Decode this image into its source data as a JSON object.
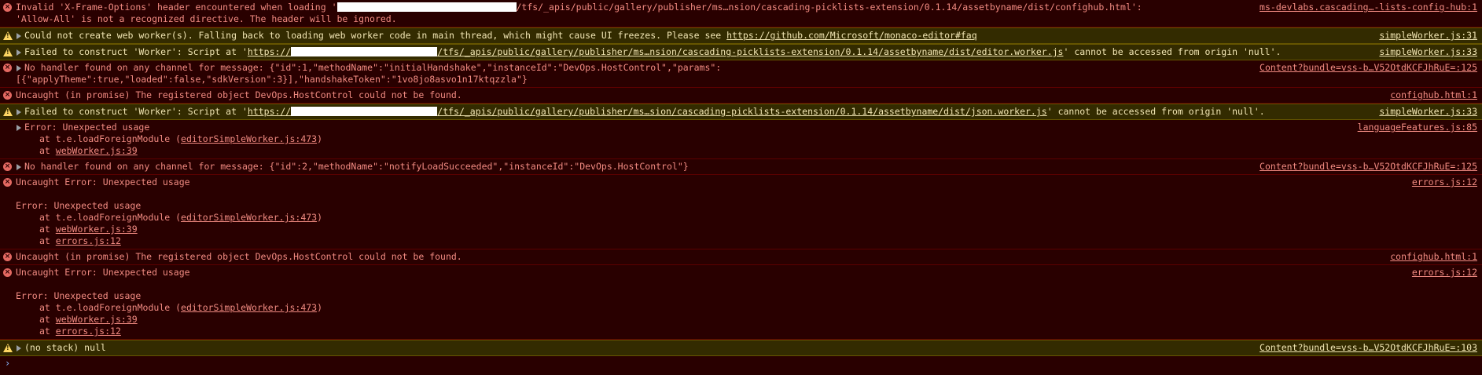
{
  "messages": [
    {
      "level": "error",
      "lines": [
        "Invalid 'X-Frame-Options' header encountered when loading '",
        "'Allow-All' is not a recognized directive. The header will be ignored."
      ],
      "url_tail": "/tfs/_apis/public/gallery/publisher/ms…nsion/cascading-picklists-extension/0.1.14/assetbyname/dist/confighub.html':",
      "source": "ms-devlabs.cascading…-lists-config-hub:1"
    },
    {
      "level": "warning",
      "text": "Could not create web worker(s). Falling back to loading web worker code in main thread, which might cause UI freezes. Please see ",
      "link": "https://github.com/Microsoft/monaco-editor#faq",
      "source": "simpleWorker.js:31"
    },
    {
      "level": "warning",
      "prefix": "Failed to construct 'Worker': Script at '",
      "link_start": "https://",
      "link_end": "/tfs/_apis/public/gallery/publisher/ms…nsion/cascading-picklists-extension/0.1.14/assetbyname/dist/editor.worker.js",
      "suffix": "' cannot be accessed from origin 'null'.",
      "source": "simpleWorker.js:33"
    },
    {
      "level": "error",
      "lines": [
        "No handler found on any channel for message: {\"id\":1,\"methodName\":\"initialHandshake\",\"instanceId\":\"DevOps.HostControl\",\"params\":",
        "[{\"applyTheme\":true,\"loaded\":false,\"sdkVersion\":3}],\"handshakeToken\":\"1vo8jo8asvo1n17ktqzzla\"}"
      ],
      "source": "Content?bundle=vss-b…V52OtdKCFJhRuE=:125"
    },
    {
      "level": "error",
      "text": "Uncaught (in promise) The registered object DevOps.HostControl could not be found.",
      "source": "confighub.html:1"
    },
    {
      "level": "warning",
      "prefix": "Failed to construct 'Worker': Script at '",
      "link_start": "https://",
      "link_end": "/tfs/_apis/public/gallery/publisher/ms…sion/cascading-picklists-extension/0.1.14/assetbyname/dist/json.worker.js",
      "suffix": "' cannot be accessed from origin 'null'.",
      "source": "simpleWorker.js:33"
    },
    {
      "level": "error",
      "text": "Error: Unexpected usage",
      "stack": [
        {
          "pre": "at t.e.loadForeignModule (",
          "link": "editorSimpleWorker.js:473",
          "post": ")"
        },
        {
          "pre": "at ",
          "link": "webWorker.js:39",
          "post": ""
        }
      ],
      "source": "languageFeatures.js:85"
    },
    {
      "level": "error",
      "text": "No handler found on any channel for message: {\"id\":2,\"methodName\":\"notifyLoadSucceeded\",\"instanceId\":\"DevOps.HostControl\"}",
      "source": "Content?bundle=vss-b…V52OtdKCFJhRuE=:125"
    },
    {
      "level": "error",
      "text": "Uncaught Error: Unexpected usage",
      "detail": "Error: Unexpected usage",
      "stack": [
        {
          "pre": "at t.e.loadForeignModule (",
          "link": "editorSimpleWorker.js:473",
          "post": ")"
        },
        {
          "pre": "at ",
          "link": "webWorker.js:39",
          "post": ""
        },
        {
          "pre": "at ",
          "link": "errors.js:12",
          "post": ""
        }
      ],
      "source": "errors.js:12"
    },
    {
      "level": "error",
      "text": "Uncaught (in promise) The registered object DevOps.HostControl could not be found.",
      "source": "confighub.html:1"
    },
    {
      "level": "error",
      "text": "Uncaught Error: Unexpected usage",
      "detail": "Error: Unexpected usage",
      "stack": [
        {
          "pre": "at t.e.loadForeignModule (",
          "link": "editorSimpleWorker.js:473",
          "post": ")"
        },
        {
          "pre": "at ",
          "link": "webWorker.js:39",
          "post": ""
        },
        {
          "pre": "at ",
          "link": "errors.js:12",
          "post": ""
        }
      ],
      "source": "errors.js:12"
    },
    {
      "level": "warning",
      "text": "(no stack) null",
      "source": "Content?bundle=vss-b…V52OtdKCFJhRuE=:103"
    }
  ],
  "prompt_symbol": "›",
  "colors": {
    "error_bg": "#290000",
    "error_text": "#f28b82",
    "warning_bg": "#332b00",
    "warning_text": "#f2e6b4",
    "error_icon": "#e46962",
    "warning_icon": "#fdd663"
  },
  "icons": {
    "error": "error-circle-icon",
    "warning": "warning-triangle-icon",
    "expand": "expand-triangle-icon"
  }
}
